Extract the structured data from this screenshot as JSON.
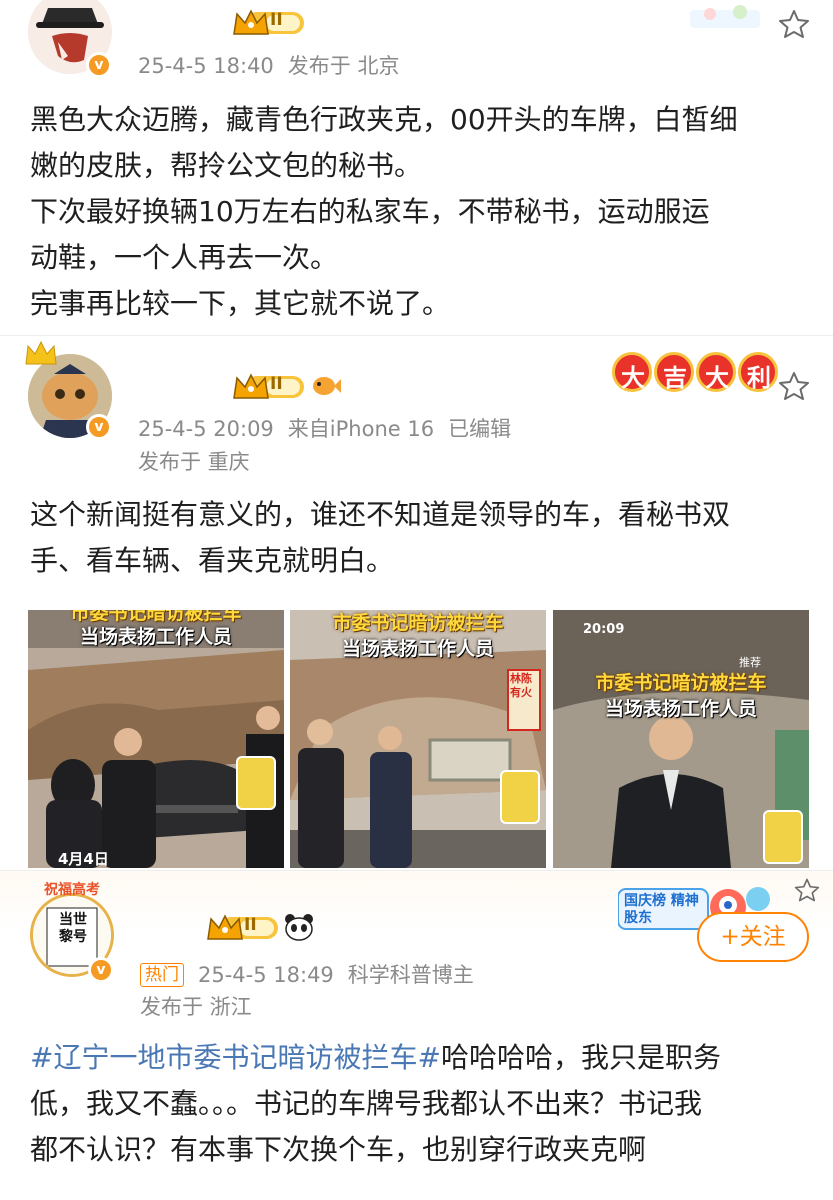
{
  "posts": [
    {
      "rank": "II",
      "timestamp": "25-4-5 18:40",
      "location": "发布于 北京",
      "lines": [
        "黑色大众迈腾，藏青色行政夹克，00开头的车牌，白皙细",
        "嫩的皮肤，帮拎公文包的秘书。",
        "下次最好换辆10万左右的私家车，不带秘书，运动服运",
        "动鞋，一个人再去一次。",
        "完事再比较一下，其它就不说了。"
      ]
    },
    {
      "rank": "II",
      "decoration": "大吉大利",
      "timestamp": "25-4-5 20:09",
      "device": "来自iPhone 16",
      "edited": "已编辑",
      "location": "发布于 重庆",
      "lines": [
        "这个新闻挺有意义的，谁还不知道是领导的车，看秘书双",
        "手、看车辆、看夹克就明白。"
      ],
      "images": [
        {
          "caption1": "市委书记暗访被拦车",
          "caption2": "当场表扬工作人员",
          "date": "4月4日"
        },
        {
          "caption1": "市委书记暗访被拦车",
          "caption2": "当场表扬工作人员",
          "sign": "林陈有火"
        },
        {
          "caption1": "市委书记暗访被拦车",
          "caption2": "当场表扬工作人员",
          "phone_time": "20:09",
          "phone_label": "推荐"
        }
      ]
    },
    {
      "rank": "II",
      "avatar_text": "祝福高考",
      "avatar_calligraphy": "当世黎号",
      "hot_tag": "热门",
      "timestamp": "25-4-5 18:49",
      "title": "科学科普博主",
      "location": "发布于 浙江",
      "follow_label": "+关注",
      "banner_text": "国庆榜 精神股东",
      "hashtag": "#辽宁一地市委书记暗访被拦车#",
      "lines": [
        "哈哈哈哈，我只是职务",
        "低，我又不蠢。。。书记的车牌号我都认不出来？书记我",
        "都不认识？有本事下次换个车，也别穿行政夹克啊"
      ]
    }
  ],
  "colors": {
    "accent": "#ff8200",
    "link": "#4a78b5",
    "meta": "#8a8a8a",
    "badge_gold": "#f5b400"
  }
}
